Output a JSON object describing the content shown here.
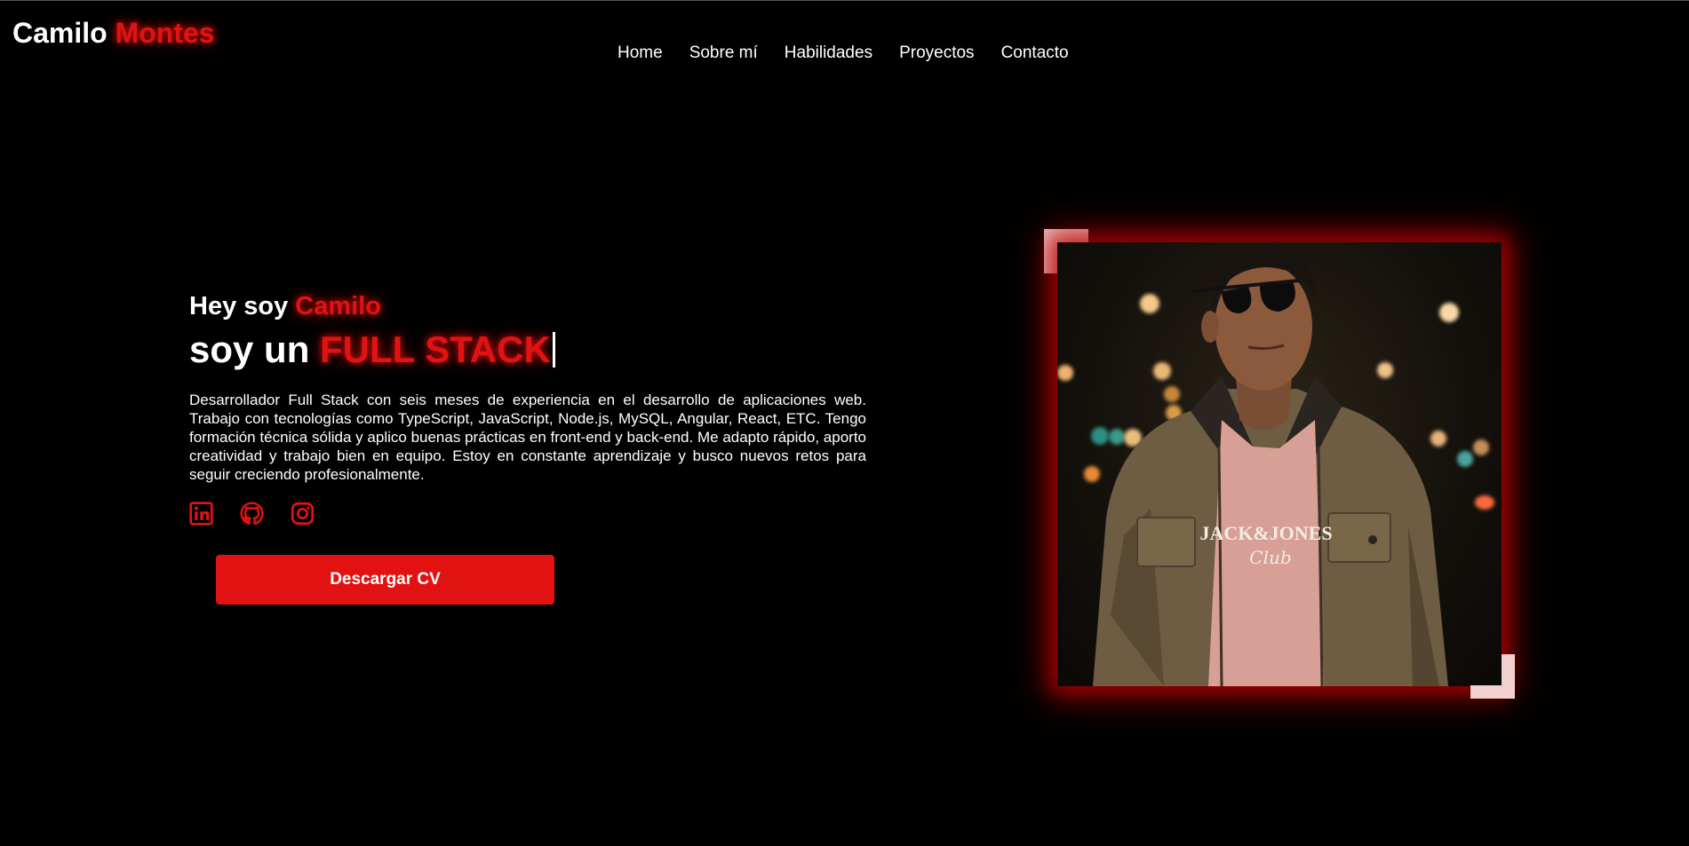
{
  "header": {
    "logo_first": "Camilo",
    "logo_last": "Montes",
    "nav": [
      "Home",
      "Sobre mí",
      "Habilidades",
      "Proyectos",
      "Contacto"
    ]
  },
  "hero": {
    "greeting_prefix": "Hey soy",
    "greeting_name": "Camilo",
    "role_prefix": "soy un",
    "role_highlight": "FULL STACK",
    "bio": "Desarrollador Full Stack con seis meses de experiencia en el desarrollo de aplicaciones web. Trabajo con tecnologías como TypeScript, JavaScript, Node.js, MySQL, Angular, React, ETC. Tengo formación técnica sólida y aplico buenas prácticas en front-end y back-end. Me adapto rápido, aporto creatividad y trabajo bien en equipo. Estoy en constante aprendizaje y busco nuevos retos para seguir creciendo profesionalmente.",
    "socials": [
      "linkedin-icon",
      "github-icon",
      "instagram-icon"
    ],
    "cv_button": "Descargar CV"
  },
  "colors": {
    "accent": "#e31212",
    "background": "#000000",
    "text": "#ffffff",
    "frame_corner": "#f3d0d0"
  },
  "photo": {
    "shirt_print_line1": "JACK&JONES",
    "shirt_print_line2": "Club"
  }
}
